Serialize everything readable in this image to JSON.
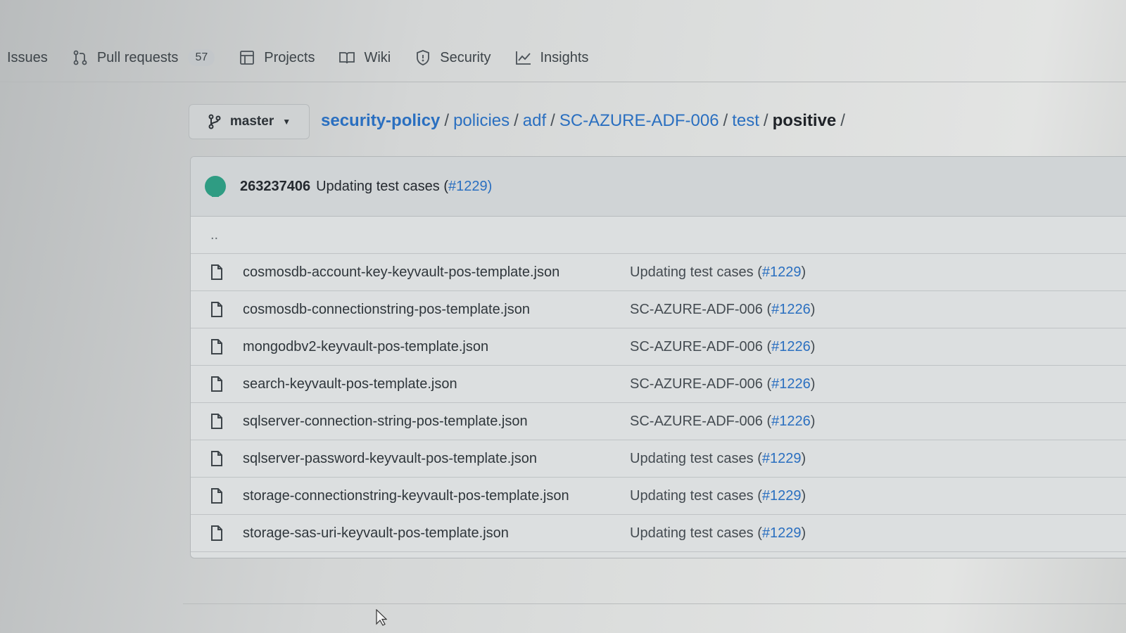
{
  "nav": {
    "issues": "Issues",
    "pull_requests": "Pull requests",
    "pull_requests_count": "57",
    "projects": "Projects",
    "wiki": "Wiki",
    "security": "Security",
    "insights": "Insights"
  },
  "branch": {
    "name": "master"
  },
  "breadcrumb": {
    "root": "security-policy",
    "parts": [
      "policies",
      "adf",
      "SC-AZURE-ADF-006",
      "test"
    ],
    "current": "positive",
    "sep": "/"
  },
  "latest_commit": {
    "sha": "263237406",
    "message": "Updating test cases (",
    "pr": "#1229",
    "close": ")"
  },
  "parent_dir": "..",
  "files": [
    {
      "name": "cosmosdb-account-key-keyvault-pos-template.json",
      "commit": "Updating test cases (",
      "pr": "#1229"
    },
    {
      "name": "cosmosdb-connectionstring-pos-template.json",
      "commit": "SC-AZURE-ADF-006 (",
      "pr": "#1226"
    },
    {
      "name": "mongodbv2-keyvault-pos-template.json",
      "commit": "SC-AZURE-ADF-006 (",
      "pr": "#1226"
    },
    {
      "name": "search-keyvault-pos-template.json",
      "commit": "SC-AZURE-ADF-006 (",
      "pr": "#1226"
    },
    {
      "name": "sqlserver-connection-string-pos-template.json",
      "commit": "SC-AZURE-ADF-006 (",
      "pr": "#1226"
    },
    {
      "name": "sqlserver-password-keyvault-pos-template.json",
      "commit": "Updating test cases (",
      "pr": "#1229"
    },
    {
      "name": "storage-connectionstring-keyvault-pos-template.json",
      "commit": "Updating test cases (",
      "pr": "#1229"
    },
    {
      "name": "storage-sas-uri-keyvault-pos-template.json",
      "commit": "Updating test cases (",
      "pr": "#1229"
    }
  ],
  "colors": {
    "link": "#2a6fc0",
    "avatar": "#2f9c83"
  }
}
